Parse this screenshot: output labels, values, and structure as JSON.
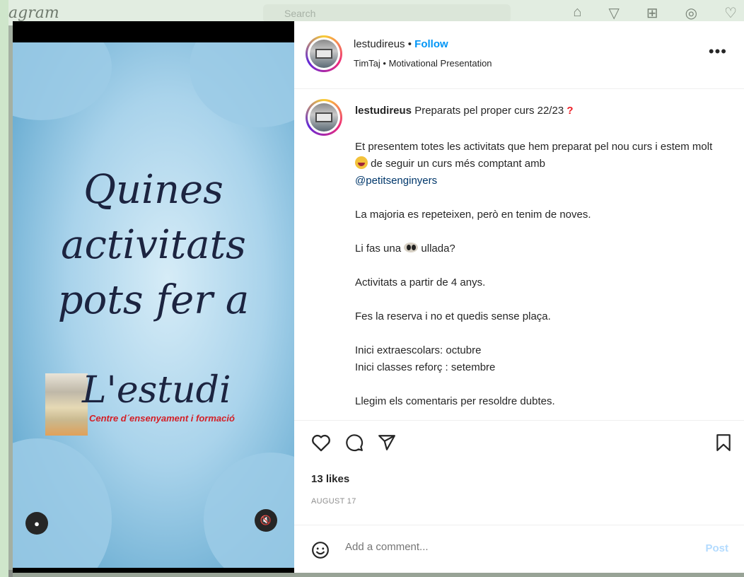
{
  "background": {
    "app_logo": "agram",
    "search_placeholder": "Search"
  },
  "media": {
    "headline_lines": [
      "Quines",
      "activitats",
      "pots fer a"
    ],
    "logo_title": "L'estudi",
    "logo_subtitle": "Centre d´ensenyament i formació"
  },
  "header": {
    "username": "lestudireus",
    "separator": "•",
    "follow_label": "Follow",
    "audio": "TimTaj • Motivational Presentation"
  },
  "caption": {
    "username": "lestudireus",
    "first_line": "Preparats pel proper curs 22/23",
    "first_line_emoji": "?",
    "para1_a": "Et presentem totes les activitats que hem preparat pel nou curs i estem molt",
    "para1_b": "de seguir un curs més comptant amb",
    "mention": "@petitsenginyers",
    "para2": "La majoria es repeteixen, però en tenim de noves.",
    "para3_a": "Li fas una",
    "para3_b": "ullada?",
    "para4": "Activitats a partir de 4 anys.",
    "para5": "Fes la reserva i no et quedis sense plaça.",
    "para6_line1": "Inici extraescolars: octubre",
    "para6_line2": "Inici classes reforç : setembre",
    "para7": "Llegim els comentaris per resoldre dubtes."
  },
  "stats": {
    "likes": "13 likes",
    "date": "AUGUST 17"
  },
  "comment": {
    "placeholder": "Add a comment...",
    "post_label": "Post"
  },
  "colors": {
    "accent": "#0095f6",
    "post_disabled": "#b3dbff",
    "page_bg": "#cfe6cb"
  }
}
